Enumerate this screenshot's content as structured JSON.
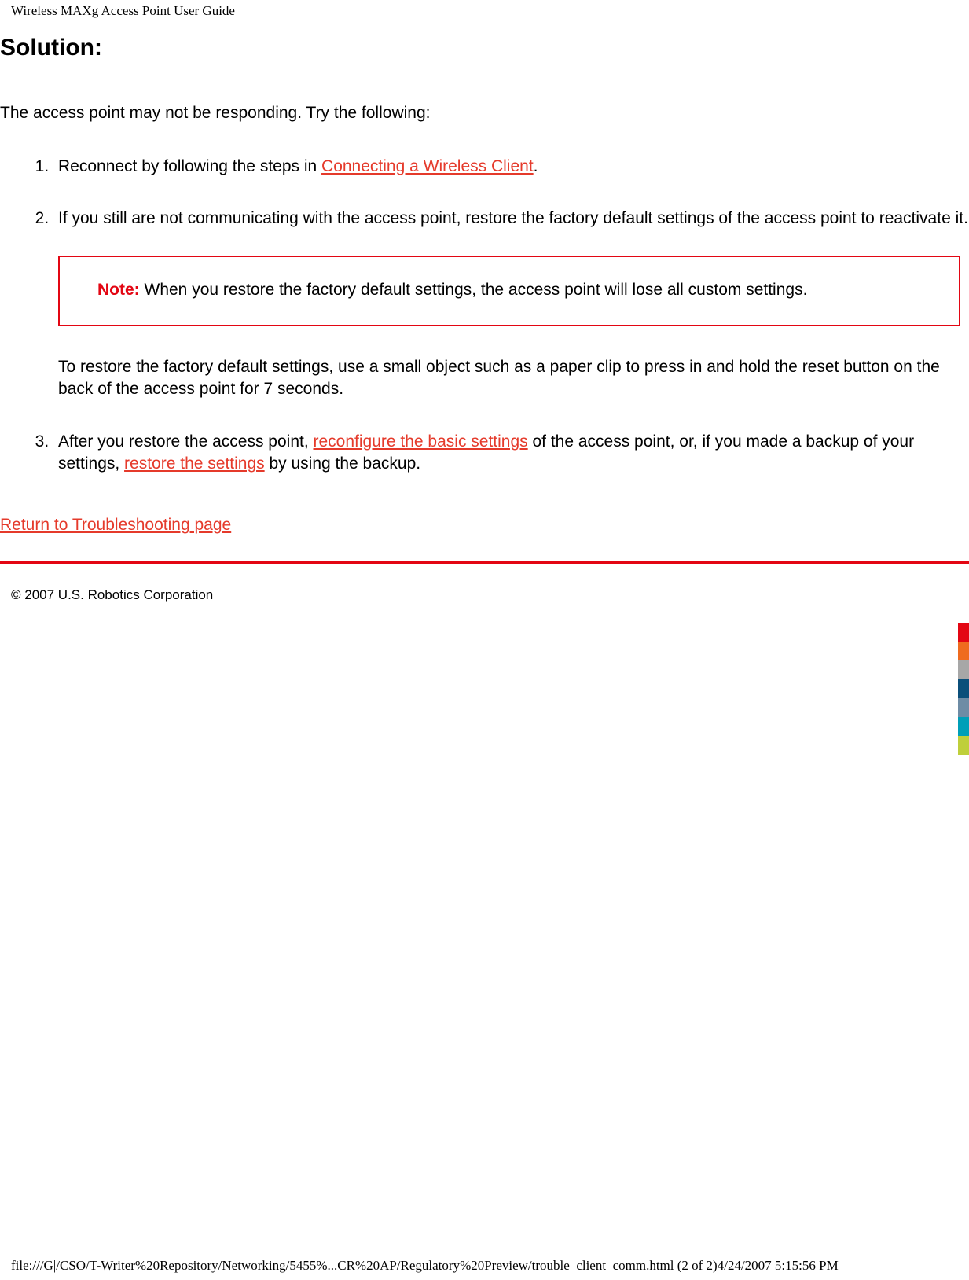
{
  "header": {
    "title": "Wireless MAXg Access Point User Guide"
  },
  "main": {
    "heading": "Solution:",
    "intro": "The access point may not be responding. Try the following:",
    "steps": {
      "s1_prefix": "Reconnect by following the steps in ",
      "s1_link": "Connecting a Wireless Client",
      "s1_suffix": ".",
      "s2_text": "If you still are not communicating with the access point, restore the factory default settings of the access point to reactivate it.",
      "note_label": "Note:",
      "note_text": " When you restore the factory default settings, the access point will lose all custom settings.",
      "s2_restore": "To restore the factory default settings, use a small object such as a paper clip to press in and hold the reset button on the back of the access point for 7 seconds.",
      "s3_prefix": "After you restore the access point, ",
      "s3_link1": "reconfigure the basic settings",
      "s3_mid": " of the access point, or, if you made a backup of your settings, ",
      "s3_link2": "restore the settings",
      "s3_suffix": " by using the backup."
    },
    "return_link": "Return to Troubleshooting page"
  },
  "footer": {
    "copyright": "© 2007 U.S. Robotics Corporation",
    "path": "file:///G|/CSO/T-Writer%20Repository/Networking/5455%...CR%20AP/Regulatory%20Preview/trouble_client_comm.html (2 of 2)4/24/2007 5:15:56 PM"
  },
  "colors": {
    "strip": [
      "#e30613",
      "#ef6b1f",
      "#a7a7a7",
      "#0b4f7a",
      "#6e8ca5",
      "#009fb8",
      "#bfcf3b"
    ]
  }
}
